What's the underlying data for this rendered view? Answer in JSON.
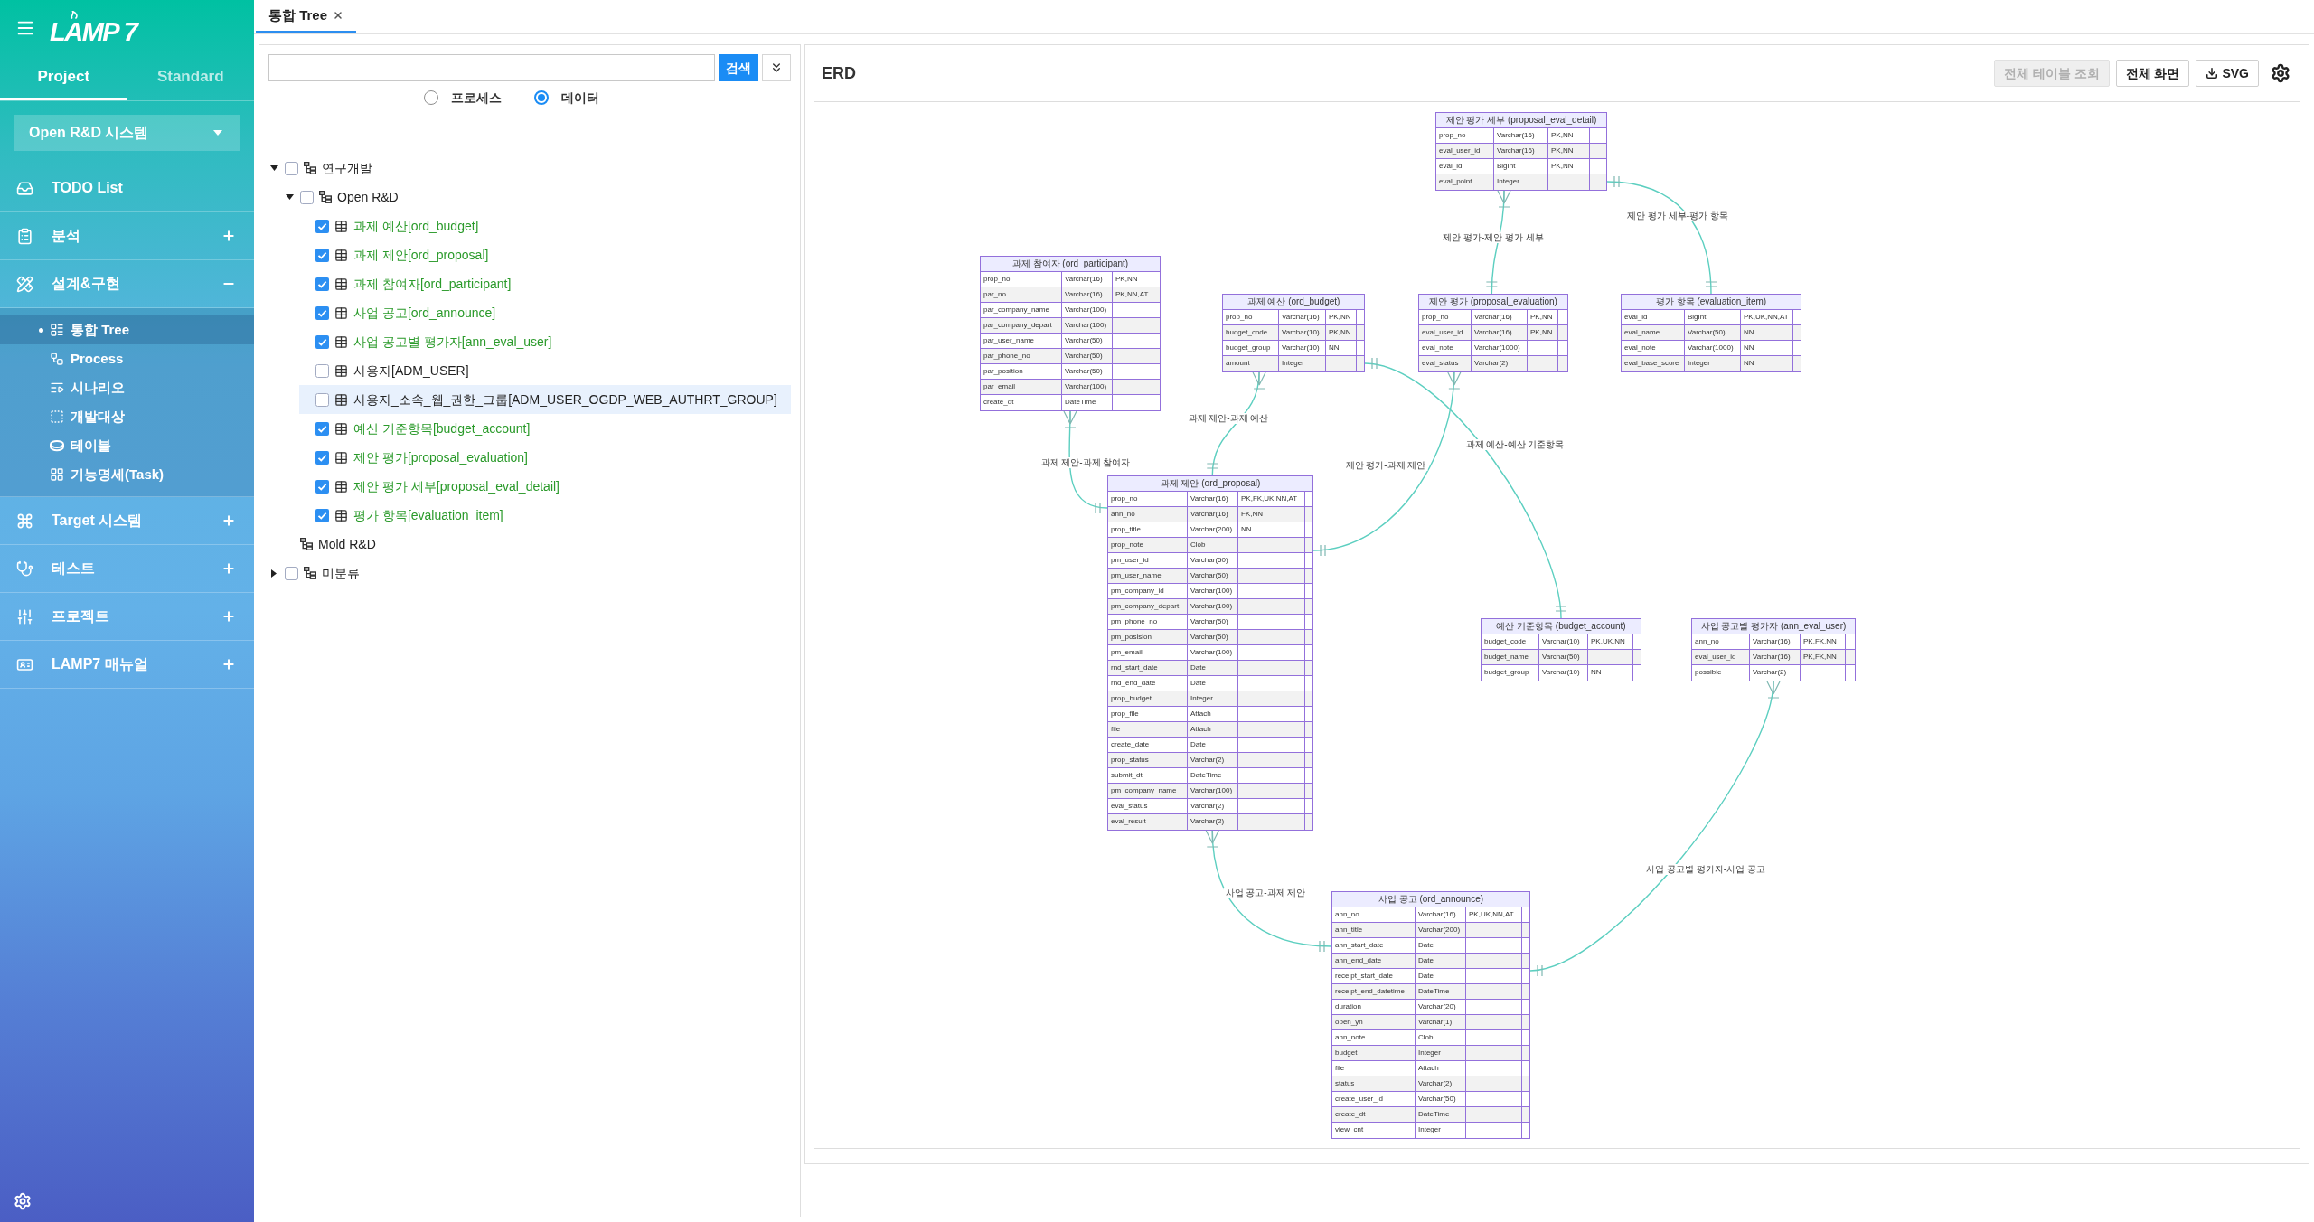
{
  "sidebar": {
    "logo": "LAMP 7",
    "tabs": [
      {
        "label": "Project",
        "selected": true
      },
      {
        "label": "Standard",
        "selected": false
      }
    ],
    "project_select": {
      "value": "Open R&D 시스템"
    },
    "menu": [
      {
        "label": "TODO List",
        "kind": "link"
      },
      {
        "label": "분석",
        "kind": "group",
        "expanded": false
      },
      {
        "label": "설계&구현",
        "kind": "group",
        "expanded": true,
        "children": [
          {
            "label": "통합 Tree",
            "selected": true
          },
          {
            "label": "Process",
            "selected": false
          },
          {
            "label": "시나리오",
            "selected": false
          },
          {
            "label": "개발대상",
            "selected": false
          },
          {
            "label": "테이블",
            "selected": false
          },
          {
            "label": "기능명세(Task)",
            "selected": false
          }
        ]
      },
      {
        "label": "Target 시스템",
        "kind": "group",
        "expanded": false
      },
      {
        "label": "테스트",
        "kind": "group",
        "expanded": false
      },
      {
        "label": "프로젝트",
        "kind": "group",
        "expanded": false
      },
      {
        "label": "LAMP7 매뉴얼",
        "kind": "group",
        "expanded": false
      }
    ]
  },
  "tabs": [
    {
      "label": "통합 Tree",
      "selected": true
    }
  ],
  "tree_panel": {
    "search": {
      "button": "검색"
    },
    "view_mode": [
      {
        "label": "프로세스",
        "selected": false
      },
      {
        "label": "데이터",
        "selected": true
      }
    ],
    "tree": [
      {
        "label": "연구개발",
        "kind": "group",
        "checked": false,
        "expanded": true,
        "selected": false,
        "children": [
          {
            "label": "Open R&D",
            "kind": "group",
            "checked": false,
            "expanded": true,
            "selected": false,
            "children": [
              {
                "label": "과제 예산[ord_budget]",
                "kind": "table",
                "checked": true,
                "selected": false
              },
              {
                "label": "과제 제안[ord_proposal]",
                "kind": "table",
                "checked": true,
                "selected": false
              },
              {
                "label": "과제 참여자[ord_participant]",
                "kind": "table",
                "checked": true,
                "selected": false
              },
              {
                "label": "사업 공고[ord_announce]",
                "kind": "table",
                "checked": true,
                "selected": false
              },
              {
                "label": "사업 공고별 평가자[ann_eval_user]",
                "kind": "table",
                "checked": true,
                "selected": false
              },
              {
                "label": "사용자[ADM_USER]",
                "kind": "table",
                "checked": false,
                "selected": false
              },
              {
                "label": "사용자_소속_웹_권한_그룹[ADM_USER_OGDP_WEB_AUTHRT_GROUP]",
                "kind": "table",
                "checked": false,
                "selected": true
              },
              {
                "label": "예산 기준항목[budget_account]",
                "kind": "table",
                "checked": true,
                "selected": false
              },
              {
                "label": "제안 평가[proposal_evaluation]",
                "kind": "table",
                "checked": true,
                "selected": false
              },
              {
                "label": "제안 평가 세부[proposal_eval_detail]",
                "kind": "table",
                "checked": true,
                "selected": false
              },
              {
                "label": "평가 항목[evaluation_item]",
                "kind": "table",
                "checked": true,
                "selected": false
              }
            ]
          },
          {
            "label": "Mold R&D",
            "kind": "group",
            "selected": false
          }
        ]
      },
      {
        "label": "미분류",
        "kind": "group",
        "checked": false,
        "expanded": false,
        "selected": false
      }
    ]
  },
  "erd": {
    "title": "ERD",
    "buttons": [
      {
        "label": "전체 테이블 조회",
        "kind": "plain",
        "disabled": true
      },
      {
        "label": "전체 화면",
        "kind": "plain",
        "disabled": false
      },
      {
        "label": "SVG",
        "kind": "download",
        "disabled": false
      }
    ],
    "tables": [
      {
        "title": "제안 평가 세부 (proposal_eval_detail)",
        "attributes": [
          [
            "prop_no",
            "Varchar(16)",
            "PK,NN"
          ],
          [
            "eval_user_id",
            "Varchar(16)",
            "PK,NN"
          ],
          [
            "eval_id",
            "BigInt",
            "PK,NN"
          ],
          [
            "eval_point",
            "Integer"
          ]
        ]
      },
      {
        "title": "과제 참여자 (ord_participant)",
        "attributes": [
          [
            "prop_no",
            "Varchar(16)",
            "PK,NN"
          ],
          [
            "par_no",
            "Varchar(16)",
            "PK,NN,AT"
          ],
          [
            "par_company_name",
            "Varchar(100)"
          ],
          [
            "par_company_depart",
            "Varchar(100)"
          ],
          [
            "par_user_name",
            "Varchar(50)"
          ],
          [
            "par_phone_no",
            "Varchar(50)"
          ],
          [
            "par_position",
            "Varchar(50)"
          ],
          [
            "par_email",
            "Varchar(100)"
          ],
          [
            "create_dt",
            "DateTime"
          ]
        ]
      },
      {
        "title": "과제 예산 (ord_budget)",
        "attributes": [
          [
            "prop_no",
            "Varchar(16)",
            "PK,NN"
          ],
          [
            "budget_code",
            "Varchar(10)",
            "PK,NN"
          ],
          [
            "budget_group",
            "Varchar(10)",
            "NN"
          ],
          [
            "amount",
            "Integer"
          ]
        ]
      },
      {
        "title": "제안 평가 (proposal_evaluation)",
        "attributes": [
          [
            "prop_no",
            "Varchar(16)",
            "PK,NN"
          ],
          [
            "eval_user_id",
            "Varchar(16)",
            "PK,NN"
          ],
          [
            "eval_note",
            "Varchar(1000)"
          ],
          [
            "eval_status",
            "Varchar(2)"
          ]
        ]
      },
      {
        "title": "평가 항목 (evaluation_item)",
        "attributes": [
          [
            "eval_id",
            "BigInt",
            "PK,UK,NN,AT"
          ],
          [
            "eval_name",
            "Varchar(50)",
            "NN"
          ],
          [
            "eval_note",
            "Varchar(1000)",
            "NN"
          ],
          [
            "eval_base_score",
            "Integer",
            "NN"
          ]
        ]
      },
      {
        "title": "과제 제안 (ord_proposal)",
        "attributes": [
          [
            "prop_no",
            "Varchar(16)",
            "PK,FK,UK,NN,AT"
          ],
          [
            "ann_no",
            "Varchar(16)",
            "FK,NN"
          ],
          [
            "prop_title",
            "Varchar(200)",
            "NN"
          ],
          [
            "prop_note",
            "Clob"
          ],
          [
            "pm_user_id",
            "Varchar(50)"
          ],
          [
            "pm_user_name",
            "Varchar(50)"
          ],
          [
            "pm_company_id",
            "Varchar(100)"
          ],
          [
            "pm_company_depart",
            "Varchar(100)"
          ],
          [
            "pm_phone_no",
            "Varchar(50)"
          ],
          [
            "pm_posision",
            "Varchar(50)"
          ],
          [
            "pm_email",
            "Varchar(100)"
          ],
          [
            "rnd_start_date",
            "Date"
          ],
          [
            "rnd_end_date",
            "Date"
          ],
          [
            "prop_budget",
            "Integer"
          ],
          [
            "prop_file",
            "Attach"
          ],
          [
            "file",
            "Attach"
          ],
          [
            "create_date",
            "Date"
          ],
          [
            "prop_status",
            "Varchar(2)"
          ],
          [
            "submit_dt",
            "DateTime"
          ],
          [
            "pm_company_name",
            "Varchar(100)"
          ],
          [
            "eval_status",
            "Varchar(2)"
          ],
          [
            "eval_result",
            "Varchar(2)"
          ]
        ]
      },
      {
        "title": "예산 기준항목 (budget_account)",
        "attributes": [
          [
            "budget_code",
            "Varchar(10)",
            "PK,UK,NN"
          ],
          [
            "budget_name",
            "Varchar(50)"
          ],
          [
            "budget_group",
            "Varchar(10)",
            "NN"
          ]
        ]
      },
      {
        "title": "사업 공고별 평가자 (ann_eval_user)",
        "attributes": [
          [
            "ann_no",
            "Varchar(16)",
            "PK,FK,NN"
          ],
          [
            "eval_user_id",
            "Varchar(16)",
            "PK,FK,NN"
          ],
          [
            "possible",
            "Varchar(2)"
          ]
        ]
      },
      {
        "title": "사업 공고 (ord_announce)",
        "attributes": [
          [
            "ann_no",
            "Varchar(16)",
            "PK,UK,NN,AT"
          ],
          [
            "ann_title",
            "Varchar(200)"
          ],
          [
            "ann_start_date",
            "Date"
          ],
          [
            "ann_end_date",
            "Date"
          ],
          [
            "receipt_start_date",
            "Date"
          ],
          [
            "receipt_end_datetime",
            "DateTime"
          ],
          [
            "duration",
            "Varchar(20)"
          ],
          [
            "open_yn",
            "Varchar(1)"
          ],
          [
            "ann_note",
            "Clob"
          ],
          [
            "budget",
            "Integer"
          ],
          [
            "file",
            "Attach"
          ],
          [
            "status",
            "Varchar(2)"
          ],
          [
            "create_user_id",
            "Varchar(50)"
          ],
          [
            "create_dt",
            "DateTime"
          ],
          [
            "view_cnt",
            "Integer"
          ]
        ]
      }
    ],
    "relationships": [
      {
        "label": "제안 평가 세부-평가 항목",
        "start_many": false,
        "end_many": false
      },
      {
        "label": "제안 평가-제안 평가 세부",
        "start_many": true,
        "end_many": false
      },
      {
        "label": "과제 제안-과제 예산",
        "start_many": true,
        "end_many": false
      },
      {
        "label": "과제 예산-예산 기준항목",
        "start_many": false,
        "end_many": false
      },
      {
        "label": "과제 제안-과제 참여자",
        "start_many": true,
        "end_many": false
      },
      {
        "label": "제안 평가-과제 제안",
        "start_many": true,
        "end_many": false
      },
      {
        "label": "사업 공고별 평가자-사업 공고",
        "start_many": true,
        "end_many": false
      },
      {
        "label": "사업 공고-과제 제안",
        "start_many": true,
        "end_many": false
      }
    ]
  }
}
